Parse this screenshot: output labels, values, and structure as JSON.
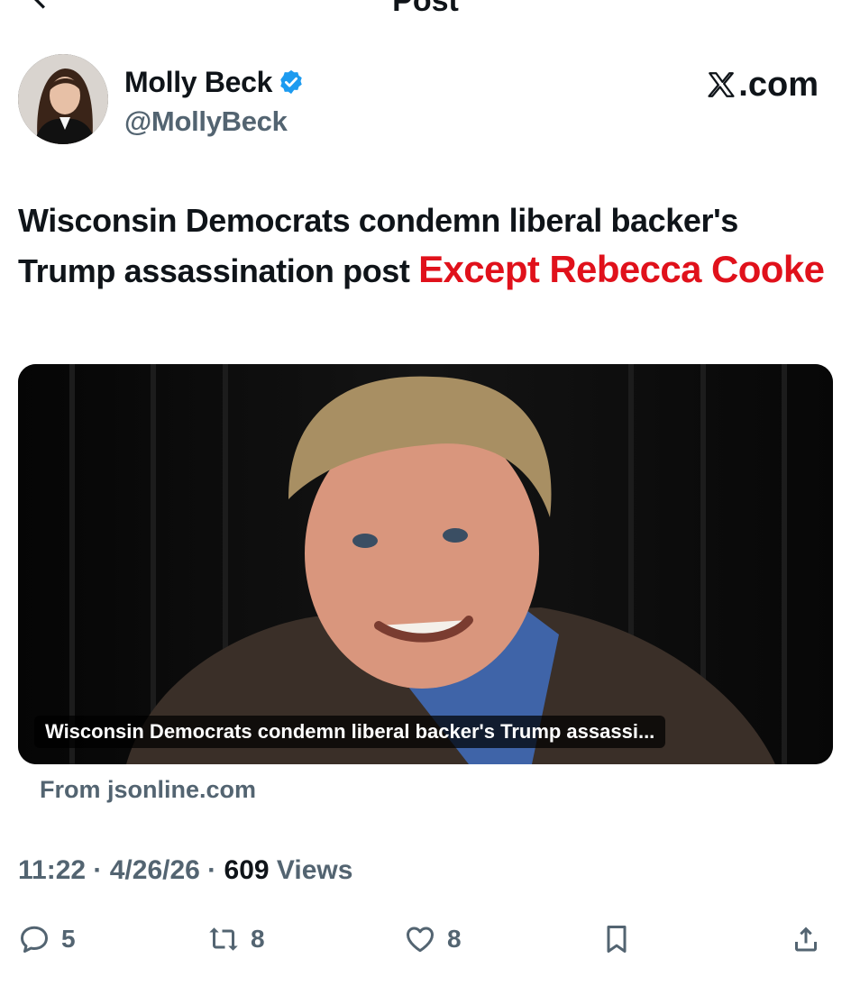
{
  "header": {
    "title": "Post",
    "back_icon": "arrow-left-icon",
    "more_icon": "more-dots-icon"
  },
  "author": {
    "display_name": "Molly Beck",
    "handle": "@MollyBeck",
    "verified": true,
    "verified_color": "#1d9bf0"
  },
  "brand": {
    "text": ".com",
    "logo_icon": "x-logo-icon"
  },
  "post": {
    "text": "Wisconsin Democrats condemn liberal backer's Trump assassination post ",
    "highlight": "Except Rebecca Cooke",
    "highlight_color": "#e0111b"
  },
  "link_card": {
    "caption": "Wisconsin Democrats condemn liberal backer's Trump assassi...",
    "source": "From jsonline.com"
  },
  "meta": {
    "time": "11:22",
    "separator": " · ",
    "date": "4/26/26",
    "views_count": "609",
    "views_label": " Views"
  },
  "actions": {
    "replies": "5",
    "reposts": "8",
    "likes": "8",
    "icon_color": "#536471"
  }
}
